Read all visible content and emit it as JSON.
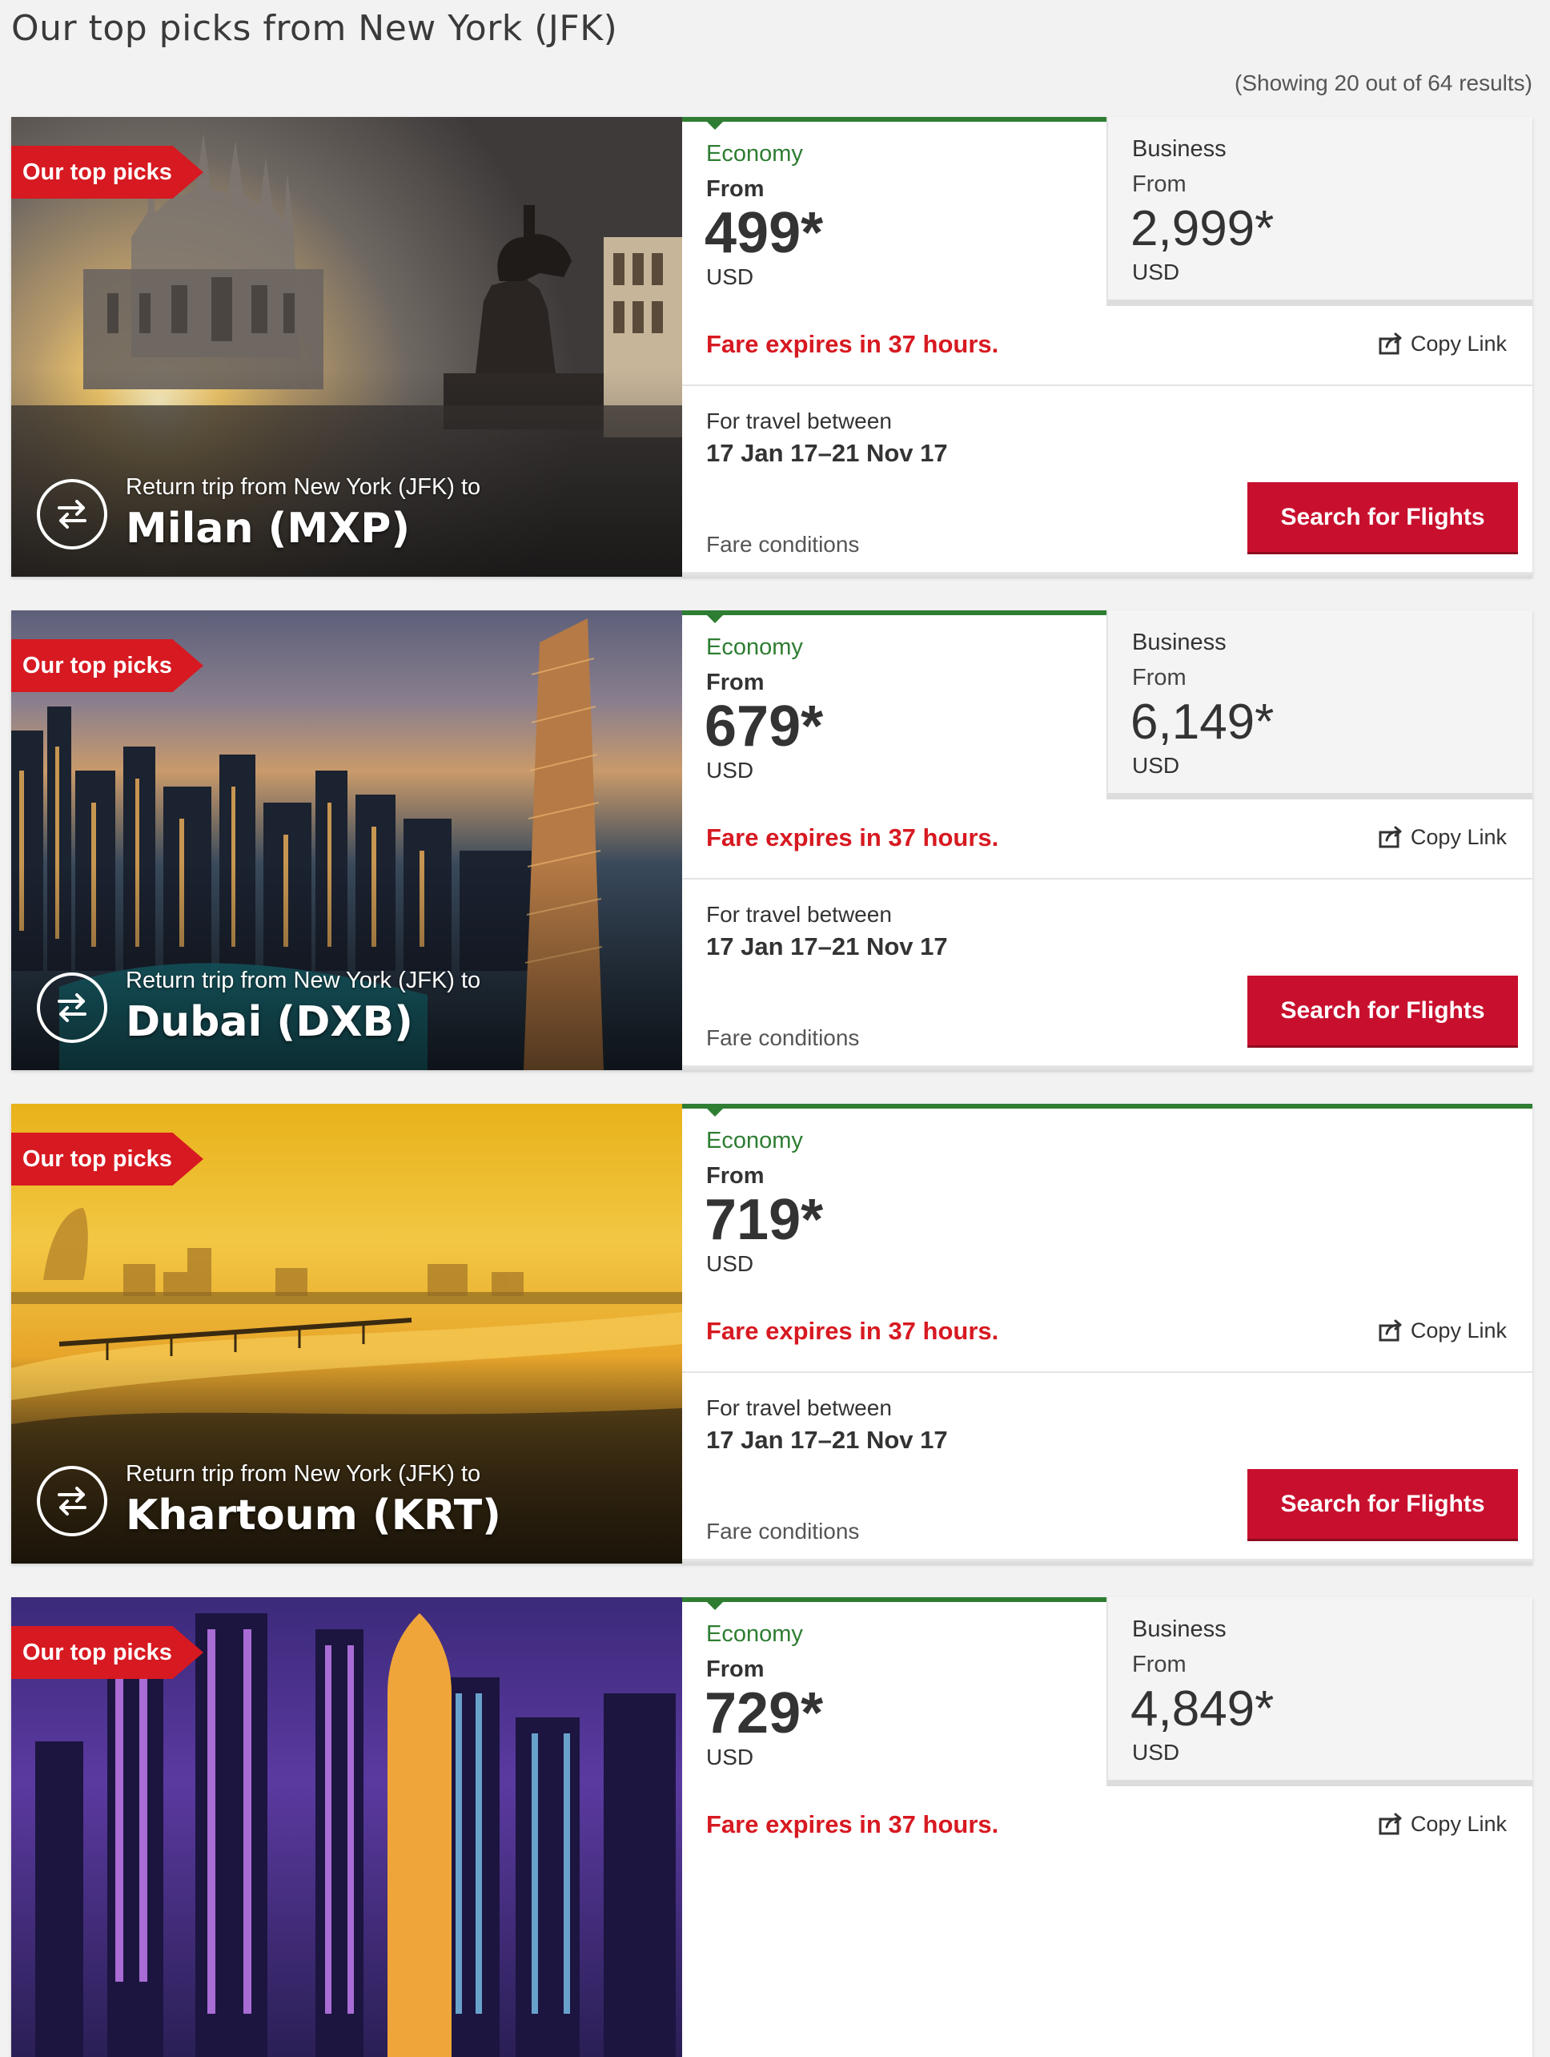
{
  "page": {
    "title": "Our top picks from New York (JFK)",
    "results_count": "(Showing 20 out of 64 results)"
  },
  "colors": {
    "brand_red": "#d71921",
    "economy_green": "#2e7d32",
    "button_red": "#c8102e"
  },
  "common": {
    "tag_label": "Our top picks",
    "trip_label": "Return trip from New York (JFK) to",
    "economy_label": "Economy",
    "business_label": "Business",
    "from_label": "From",
    "currency": "USD",
    "copy_link_label": "Copy Link",
    "travel_between_label": "For travel between",
    "fare_conditions_label": "Fare conditions",
    "search_button_label": "Search for Flights",
    "icons": [
      "return-trip-icon",
      "copy-link-icon"
    ]
  },
  "cards": [
    {
      "destination": "Milan (MXP)",
      "economy_price": "499*",
      "business_price": "2,999*",
      "expiry": "Fare expires in 37 hours.",
      "travel_dates": "17 Jan 17–21 Nov 17"
    },
    {
      "destination": "Dubai (DXB)",
      "economy_price": "679*",
      "business_price": "6,149*",
      "expiry": "Fare expires in 37 hours.",
      "travel_dates": "17 Jan 17–21 Nov 17"
    },
    {
      "destination": "Khartoum (KRT)",
      "economy_price": "719*",
      "business_price": null,
      "expiry": "Fare expires in 37 hours.",
      "travel_dates": "17 Jan 17–21 Nov 17"
    },
    {
      "destination": "",
      "economy_price": "729*",
      "business_price": "4,849*",
      "expiry": "Fare expires in 37 hours.",
      "travel_dates": ""
    }
  ]
}
